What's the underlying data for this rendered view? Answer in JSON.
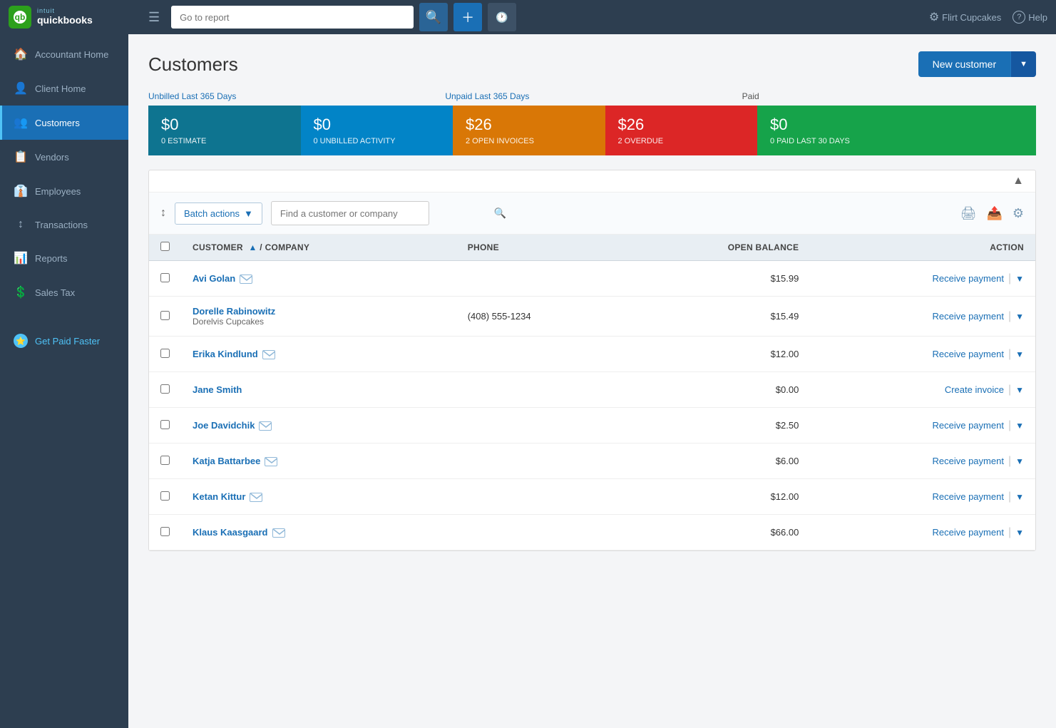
{
  "topNav": {
    "searchPlaceholder": "Go to report",
    "companyName": "Flirt Cupcakes",
    "helpLabel": "Help"
  },
  "sidebar": {
    "items": [
      {
        "id": "accountant-home",
        "label": "Accountant Home",
        "icon": "🏠",
        "active": false
      },
      {
        "id": "client-home",
        "label": "Client Home",
        "icon": "👤",
        "active": false
      },
      {
        "id": "customers",
        "label": "Customers",
        "icon": "👥",
        "active": true
      },
      {
        "id": "vendors",
        "label": "Vendors",
        "icon": "📋",
        "active": false
      },
      {
        "id": "employees",
        "label": "Employees",
        "icon": "👔",
        "active": false
      },
      {
        "id": "transactions",
        "label": "Transactions",
        "icon": "↕",
        "active": false
      },
      {
        "id": "reports",
        "label": "Reports",
        "icon": "📊",
        "active": false
      },
      {
        "id": "sales-tax",
        "label": "Sales Tax",
        "icon": "💲",
        "active": false
      },
      {
        "id": "get-paid-faster",
        "label": "Get Paid Faster",
        "icon": "⭐",
        "active": false,
        "special": true
      }
    ]
  },
  "page": {
    "title": "Customers",
    "newCustomerBtn": "New customer"
  },
  "summary": {
    "unbilledLabel": "Unbilled Last 365 Days",
    "unpaidLabel": "Unpaid Last 365 Days",
    "paidLabel": "Paid",
    "cards": [
      {
        "id": "estimate",
        "amount": "$0",
        "label": "0 ESTIMATE",
        "color": "card-teal"
      },
      {
        "id": "unbilled",
        "amount": "$0",
        "label": "0 UNBILLED ACTIVITY",
        "color": "card-blue"
      },
      {
        "id": "open-invoices",
        "amount": "$26",
        "label": "2 OPEN INVOICES",
        "color": "card-orange"
      },
      {
        "id": "overdue",
        "amount": "$26",
        "label": "2 OVERDUE",
        "color": "card-red"
      },
      {
        "id": "paid",
        "amount": "$0",
        "label": "0 PAID LAST 30 DAYS",
        "color": "card-green"
      }
    ]
  },
  "toolbar": {
    "batchActionsLabel": "Batch actions",
    "searchPlaceholder": "Find a customer or company"
  },
  "table": {
    "headers": [
      {
        "id": "customer",
        "label": "CUSTOMER",
        "sortable": true,
        "sorted": "asc"
      },
      {
        "id": "company",
        "label": "COMPANY",
        "sortable": false
      },
      {
        "id": "phone",
        "label": "PHONE",
        "sortable": false
      },
      {
        "id": "open-balance",
        "label": "OPEN BALANCE",
        "sortable": false,
        "align": "right"
      },
      {
        "id": "action",
        "label": "ACTION",
        "sortable": false,
        "align": "right"
      }
    ],
    "rows": [
      {
        "id": 1,
        "name": "Avi Golan",
        "email": true,
        "company": "",
        "phone": "",
        "balance": "$15.99",
        "action": "Receive payment"
      },
      {
        "id": 2,
        "name": "Dorelle Rabinowitz",
        "email": false,
        "company": "Dorelvis Cupcakes",
        "phone": "(408) 555-1234",
        "balance": "$15.49",
        "action": "Receive payment"
      },
      {
        "id": 3,
        "name": "Erika Kindlund",
        "email": true,
        "company": "",
        "phone": "",
        "balance": "$12.00",
        "action": "Receive payment"
      },
      {
        "id": 4,
        "name": "Jane Smith",
        "email": false,
        "company": "",
        "phone": "",
        "balance": "$0.00",
        "action": "Create invoice"
      },
      {
        "id": 5,
        "name": "Joe Davidchik",
        "email": true,
        "company": "",
        "phone": "",
        "balance": "$2.50",
        "action": "Receive payment"
      },
      {
        "id": 6,
        "name": "Katja Battarbee",
        "email": true,
        "company": "",
        "phone": "",
        "balance": "$6.00",
        "action": "Receive payment"
      },
      {
        "id": 7,
        "name": "Ketan Kittur",
        "email": true,
        "company": "",
        "phone": "",
        "balance": "$12.00",
        "action": "Receive payment"
      },
      {
        "id": 8,
        "name": "Klaus Kaasgaard",
        "email": true,
        "company": "",
        "phone": "",
        "balance": "$66.00",
        "action": "Receive payment"
      }
    ]
  }
}
